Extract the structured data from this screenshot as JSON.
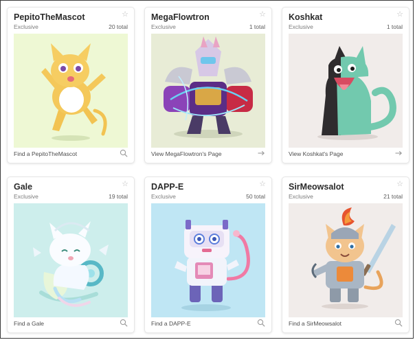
{
  "cards": [
    {
      "title": "PepitoTheMascot",
      "subtitle": "Exclusive",
      "count": "20 total",
      "footer": "Find a PepitoTheMascot",
      "footer_icon": "search-icon",
      "art_bg": "#eef8d4",
      "art": "yellow-white-cat"
    },
    {
      "title": "MegaFlowtron",
      "subtitle": "Exclusive",
      "count": "1 total",
      "footer": "View MegaFlowtron's Page",
      "footer_icon": "arrow-right-icon",
      "art_bg": "#e8ecd6",
      "art": "purple-armored-robot-cat"
    },
    {
      "title": "Koshkat",
      "subtitle": "Exclusive",
      "count": "1 total",
      "footer": "View Koshkat's Page",
      "footer_icon": "arrow-right-icon",
      "art_bg": "#f1ecea",
      "art": "black-teal-cat"
    },
    {
      "title": "Gale",
      "subtitle": "Exclusive",
      "count": "19 total",
      "footer": "Find a Gale",
      "footer_icon": "search-icon",
      "art_bg": "#cdeeec",
      "art": "white-wind-cat"
    },
    {
      "title": "DAPP-E",
      "subtitle": "Exclusive",
      "count": "50 total",
      "footer": "Find a DAPP-E",
      "footer_icon": "search-icon",
      "art_bg": "#bfe6f4",
      "art": "pink-robot-cat"
    },
    {
      "title": "SirMeowsalot",
      "subtitle": "Exclusive",
      "count": "21 total",
      "footer": "Find a SirMeowsalot",
      "footer_icon": "search-icon",
      "art_bg": "#f1ecea",
      "art": "knight-cat"
    }
  ]
}
